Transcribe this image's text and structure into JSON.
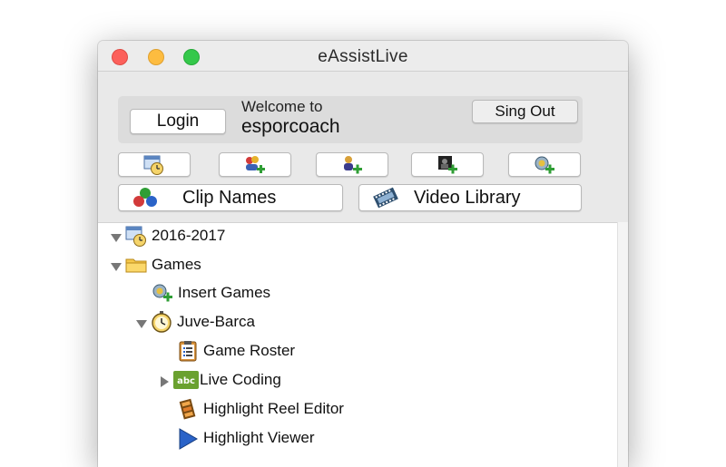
{
  "window": {
    "title": "eAssistLive"
  },
  "account": {
    "login_label": "Login",
    "welcome_label": "Welcome to",
    "username": "esporcoach",
    "signout_label": "Sing Out"
  },
  "toolbar": {
    "icons": [
      "calendar-clock-icon",
      "add-team-icon",
      "add-player-icon",
      "add-video-icon",
      "add-game-icon"
    ]
  },
  "actions": {
    "clip_names_label": "Clip Names",
    "video_library_label": "Video Library"
  },
  "tree": {
    "items": [
      {
        "label": "2016-2017",
        "icon": "season-calendar-icon",
        "disclosure": "expanded"
      },
      {
        "label": "Games",
        "icon": "folder-icon",
        "disclosure": "expanded"
      },
      {
        "label": "Insert Games",
        "icon": "insert-game-icon",
        "disclosure": "none"
      },
      {
        "label": "Juve-Barca",
        "icon": "stopwatch-icon",
        "disclosure": "expanded"
      },
      {
        "label": "Game Roster",
        "icon": "roster-clipboard-icon",
        "disclosure": "none"
      },
      {
        "label": "Live Coding",
        "icon": "abc-tag-icon",
        "disclosure": "collapsed"
      },
      {
        "label": "Highlight Reel Editor",
        "icon": "film-reel-icon",
        "disclosure": "none"
      },
      {
        "label": "Highlight Viewer",
        "icon": "play-icon",
        "disclosure": "none"
      }
    ]
  },
  "colors": {
    "close": "#fc605b",
    "minimize": "#fdbc40",
    "zoom": "#34c84a",
    "abc_tag": "#6aa12f",
    "play": "#2a63c8"
  }
}
